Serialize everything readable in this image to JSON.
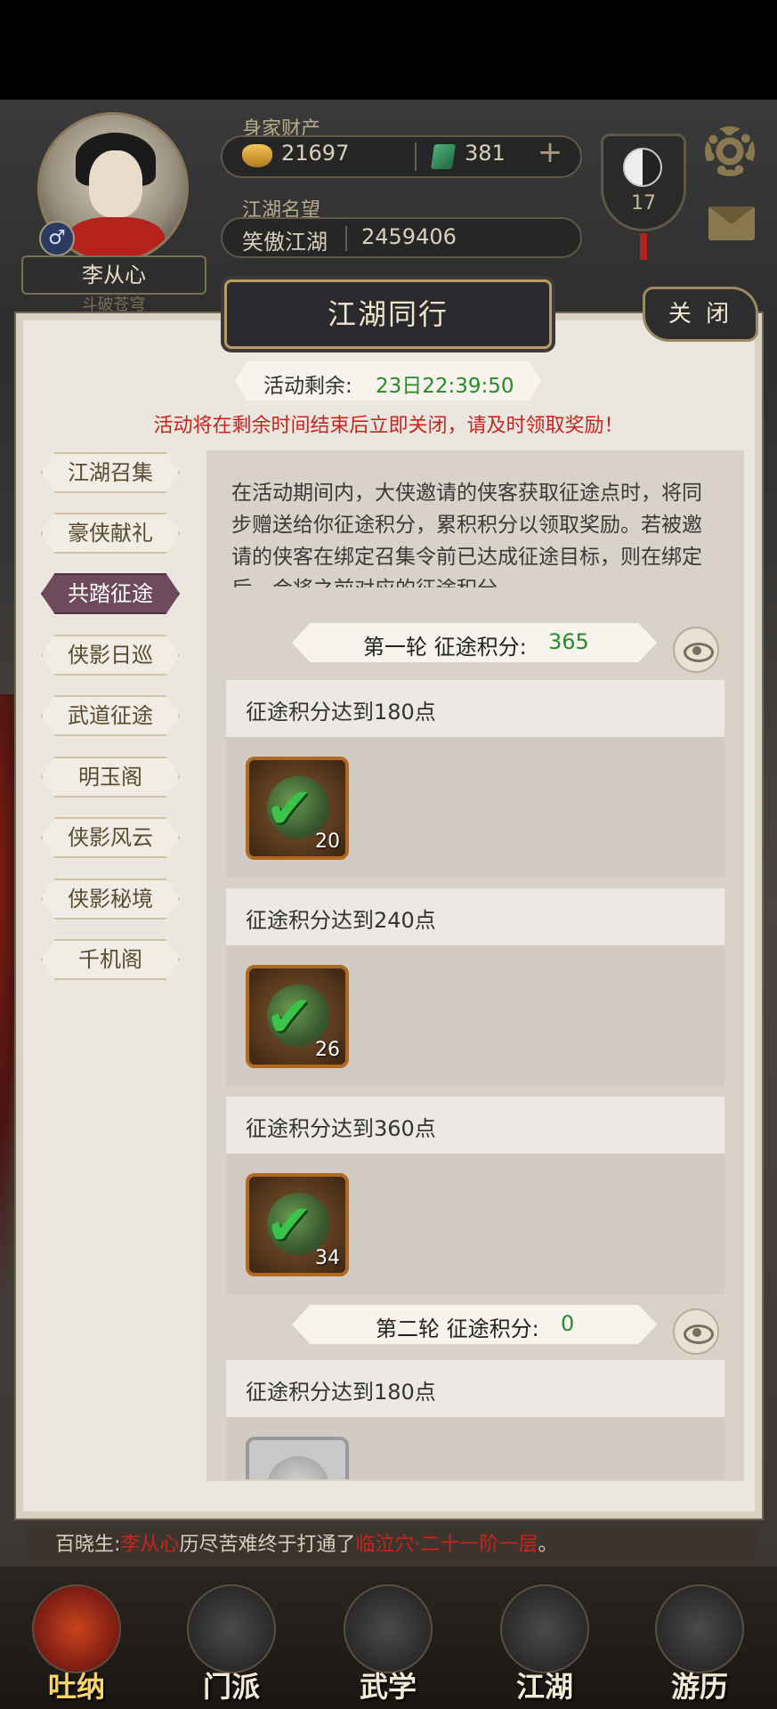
{
  "header": {
    "player_name": "李从心",
    "sub_title": "斗破苍穹",
    "gender_symbol": "♂",
    "wealth_label": "身家财产",
    "gold": "21697",
    "jade": "381",
    "plus_symbol": "+",
    "fame_label": "江湖名望",
    "fame_title": "笑傲江湖",
    "fame_value": "2459406",
    "level": "17"
  },
  "panel": {
    "title": "江湖同行",
    "close_label": "关 闭",
    "timer_label": "活动剩余:",
    "timer_value": "23日22:39:50",
    "warning": "活动将在剩余时间结束后立即关闭，请及时领取奖励！"
  },
  "sidebar": {
    "items": [
      {
        "label": "江湖召集"
      },
      {
        "label": "豪侠献礼"
      },
      {
        "label": "共踏征途"
      },
      {
        "label": "侠影日巡"
      },
      {
        "label": "武道征途"
      },
      {
        "label": "明玉阁"
      },
      {
        "label": "侠影风云"
      },
      {
        "label": "侠影秘境"
      },
      {
        "label": "千机阁"
      }
    ],
    "active_index": 2
  },
  "content": {
    "description": "在活动期间内，大侠邀请的侠客获取征途点时，将同步赠送给你征途积分，累积积分以领取奖励。若被邀请的侠客在绑定召集令前已达成征途目标，则在绑定后，会将之前对应的征途积分",
    "round1": {
      "label": "第一轮 征途积分:",
      "value": "365"
    },
    "round2": {
      "label": "第二轮 征途积分:",
      "value": "0"
    },
    "tasks": [
      {
        "title": "征途积分达到180点",
        "count": "20",
        "check": "✔"
      },
      {
        "title": "征途积分达到240点",
        "count": "26",
        "check": "✔"
      },
      {
        "title": "征途积分达到360点",
        "count": "34",
        "check": "✔"
      },
      {
        "title": "征途积分达到180点",
        "count": "",
        "check": ""
      }
    ]
  },
  "marquee": {
    "prefix": "百晓生:",
    "name": "李从心",
    "middle": "历尽苦难终于打通了",
    "place": "临泣穴·二十一阶一层",
    "suffix": "。"
  },
  "nav": {
    "items": [
      {
        "label": "吐纳"
      },
      {
        "label": "门派"
      },
      {
        "label": "武学"
      },
      {
        "label": "江湖"
      },
      {
        "label": "游历"
      }
    ]
  },
  "colors": {
    "accent_red": "#c8241c",
    "score_green": "#2a8a2a",
    "active_tab": "#6e4a5a"
  }
}
